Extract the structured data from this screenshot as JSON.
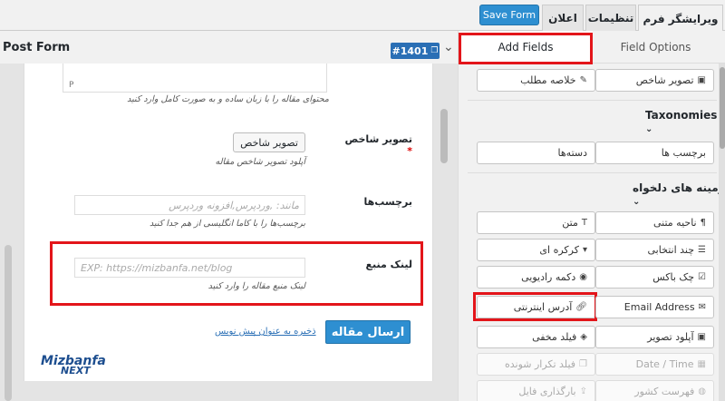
{
  "top_tabs": {
    "form_editor": "ویرایشگر فرم",
    "settings": "تنظیمات",
    "notification": "اعلان",
    "save_button": "Save Form"
  },
  "header": {
    "title": "Post Form",
    "form_id": "#1401"
  },
  "form": {
    "content_help": "محتوای مقاله را با زبان ساده و به صورت کامل وارد کنید",
    "content_p": "P",
    "featured_label": "تصویر شاخص",
    "featured_required": "*",
    "featured_button": "تصویر شاخص",
    "featured_help": "آپلود تصویر شاخص مقاله",
    "tags_label": "برچسب‌ها",
    "tags_placeholder": "مانند: ,وردپرس,افزونه وردپرس",
    "tags_help": "برچسب‌ها را با کاما انگلیسی از هم جدا کنید",
    "source_label": "لینک منبع",
    "source_placeholder": "EXP: https://mizbanfa.net/blog",
    "source_help": "لینک منبع مقاله را وارد کنید",
    "submit_button": "ارسال مقاله",
    "draft_link": "ذخیره به عنوان پیش نویس",
    "logo_line1": "Mizbanfa",
    "logo_line2": "NEXT"
  },
  "panel": {
    "tab_add": "Add Fields",
    "tab_options": "Field Options",
    "excerpt": "خلاصه مطلب",
    "featured_image": "تصویر شاخص",
    "taxonomies_title": "Taxonomies",
    "categories": "دسته‌ها",
    "tags": "برچسب ها",
    "custom_fields_title": "زمینه های دلخواه",
    "text": "متن",
    "textarea": "ناحیه متنی",
    "dropdown": "کرکره ای",
    "multi_select": "چند انتخابی",
    "radio": "دکمه رادیویی",
    "checkbox": "چک باکس",
    "url": "آدرس اینترنتی",
    "email": "Email Address",
    "hidden": "فیلد مخفی",
    "image_upload": "آپلود تصویر",
    "repeat": "فیلد تکرار شونده",
    "datetime": "Date / Time",
    "file_upload": "بارگذاری فایل",
    "country": "فهرست کشور"
  },
  "colors": {
    "accent": "#2e8fd1",
    "highlight": "#e3151a"
  }
}
